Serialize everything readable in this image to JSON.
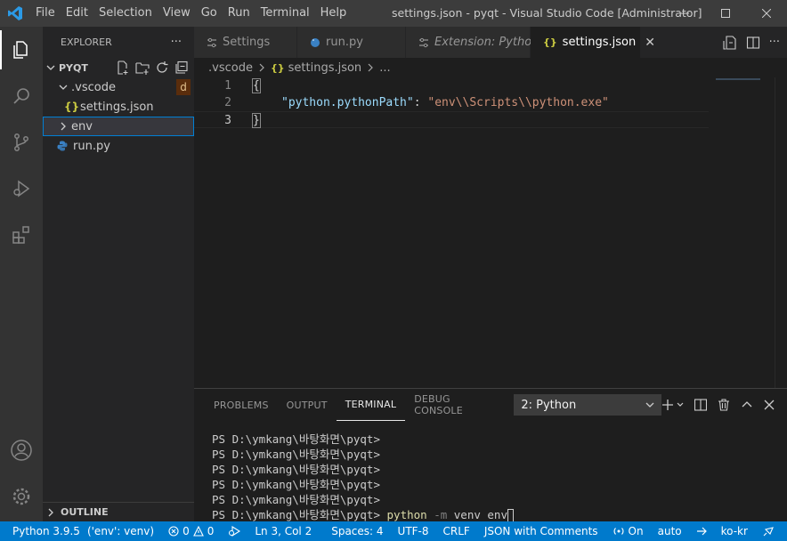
{
  "titlebar": {
    "menu": [
      "File",
      "Edit",
      "Selection",
      "View",
      "Go",
      "Run",
      "Terminal",
      "Help"
    ],
    "window_title": "settings.json - pyqt - Visual Studio Code [Administrator]"
  },
  "sidebar": {
    "header": "EXPLORER",
    "more": "···",
    "folder": "PYQT",
    "tree": [
      {
        "label": ".vscode",
        "badge": "d"
      },
      {
        "label": "settings.json"
      },
      {
        "label": "env"
      },
      {
        "label": "run.py"
      }
    ],
    "outline": "OUTLINE"
  },
  "tabs": [
    {
      "label": "Settings"
    },
    {
      "label": "run.py"
    },
    {
      "label": "Extension: Python"
    },
    {
      "label": "settings.json",
      "close": "✕"
    }
  ],
  "breadcrumb": {
    "folder": ".vscode",
    "file": "settings.json",
    "more": "..."
  },
  "editor": {
    "line_numbers": [
      "1",
      "2",
      "3"
    ],
    "line1": "{",
    "key": "\"python.pythonPath\"",
    "colon": ": ",
    "value": "\"env\\\\Scripts\\\\python.exe\"",
    "line3": "}"
  },
  "panel": {
    "tabs": [
      "PROBLEMS",
      "OUTPUT",
      "TERMINAL",
      "DEBUG CONSOLE"
    ],
    "terminal_select": "2: Python",
    "prompt": "PS D:\\ymkang\\바탕화면\\pyqt> ",
    "cmd_python": "python",
    "cmd_flag": " -m ",
    "cmd_rest": "venv env"
  },
  "statusbar": {
    "python": "Python 3.9.5",
    "env": "('env': venv)",
    "errors": "0",
    "warnings": "0",
    "position": "Ln 3, Col 2",
    "spaces": "Spaces: 4",
    "encoding": "UTF-8",
    "eol": "CRLF",
    "language": "JSON with Comments",
    "live": "On",
    "auto": "auto",
    "locale": "ko-kr"
  },
  "colors": {
    "accent": "#007acc",
    "title_bar": "#3c3c3c",
    "activity_bar": "#333333",
    "sidebar": "#252526",
    "editor": "#1e1e1e"
  }
}
